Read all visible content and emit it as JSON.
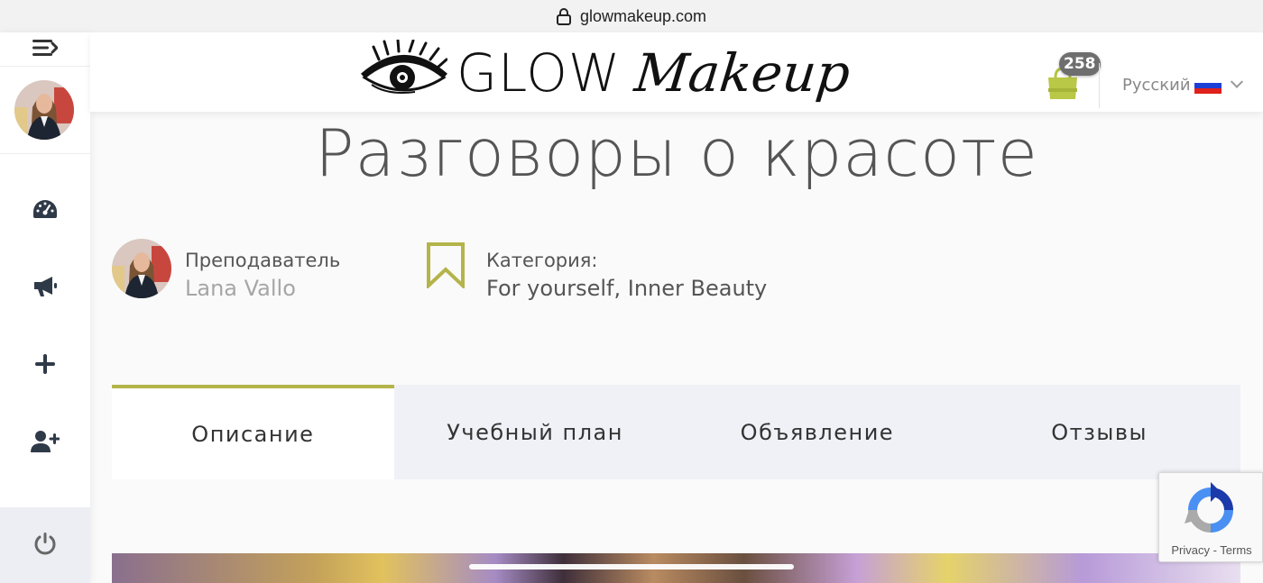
{
  "browser": {
    "url": "glowmakeup.com"
  },
  "header": {
    "logo_text_1": "GLOW",
    "logo_text_2": "Makeup",
    "cart_count": "258",
    "language": "Русский",
    "accent_color": "#b4b44a"
  },
  "sidebar": {
    "icons": [
      "menu-icon",
      "dashboard-icon",
      "megaphone-icon",
      "plus-icon",
      "add-user-icon",
      "power-icon"
    ]
  },
  "course": {
    "title": "Разговоры о красоте",
    "teacher_label": "Преподаватель",
    "teacher_name": "Lana Vallo",
    "category_label": "Категория:",
    "category_value": "For yourself, Inner Beauty"
  },
  "tabs": [
    {
      "label": "Описание",
      "active": true
    },
    {
      "label": "Учебный план",
      "active": false
    },
    {
      "label": "Объявление",
      "active": false
    },
    {
      "label": "Отзывы",
      "active": false
    }
  ],
  "recaptcha": {
    "privacy": "Privacy",
    "separator": " - ",
    "terms": "Terms"
  }
}
